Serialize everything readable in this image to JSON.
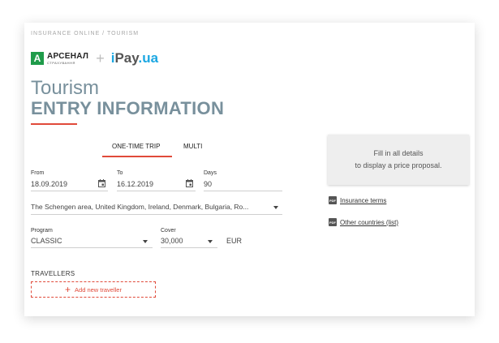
{
  "breadcrumb": "INSURANCE ONLINE / TOURISM",
  "logos": {
    "arsenal_mark": "A",
    "arsenal_name": "АРСЕНАЛ",
    "arsenal_sub": "СТРАХУВАННЯ",
    "separator": "+",
    "ipay_i": "i",
    "ipay_pay": "Pay",
    "ipay_ua": ".ua"
  },
  "heading": {
    "title": "Tourism",
    "subtitle": "ENTRY INFORMATION"
  },
  "tabs": [
    {
      "label": "ONE-TIME TRIP",
      "active": true
    },
    {
      "label": "MULTI",
      "active": false
    }
  ],
  "form": {
    "from_label": "From",
    "from_value": "18.09.2019",
    "to_label": "To",
    "to_value": "16.12.2019",
    "days_label": "Days",
    "days_value": "90",
    "territory_value": "The Schengen area, United Kingdom, Ireland, Denmark, Bulgaria, Ro...",
    "program_label": "Program",
    "program_value": "CLASSIC",
    "cover_label": "Cover",
    "cover_value": "30,000",
    "currency": "EUR"
  },
  "price_box": {
    "line1": "Fill in all details",
    "line2": "to display a price proposal."
  },
  "links": {
    "insurance_terms": "Insurance terms",
    "other_countries": "Other countries (list)",
    "pdf_icon_text": "PDF"
  },
  "travellers": {
    "heading": "TRAVELLERS",
    "add_button": "Add new traveller",
    "add_icon": "+"
  },
  "colors": {
    "accent": "#e04a3a",
    "title": "#78909c",
    "arsenal_green": "#1f9b4a",
    "ipay_blue": "#1ca7e2"
  },
  "icons": [
    "calendar-icon",
    "dropdown-caret-icon",
    "pdf-icon",
    "plus-icon"
  ]
}
